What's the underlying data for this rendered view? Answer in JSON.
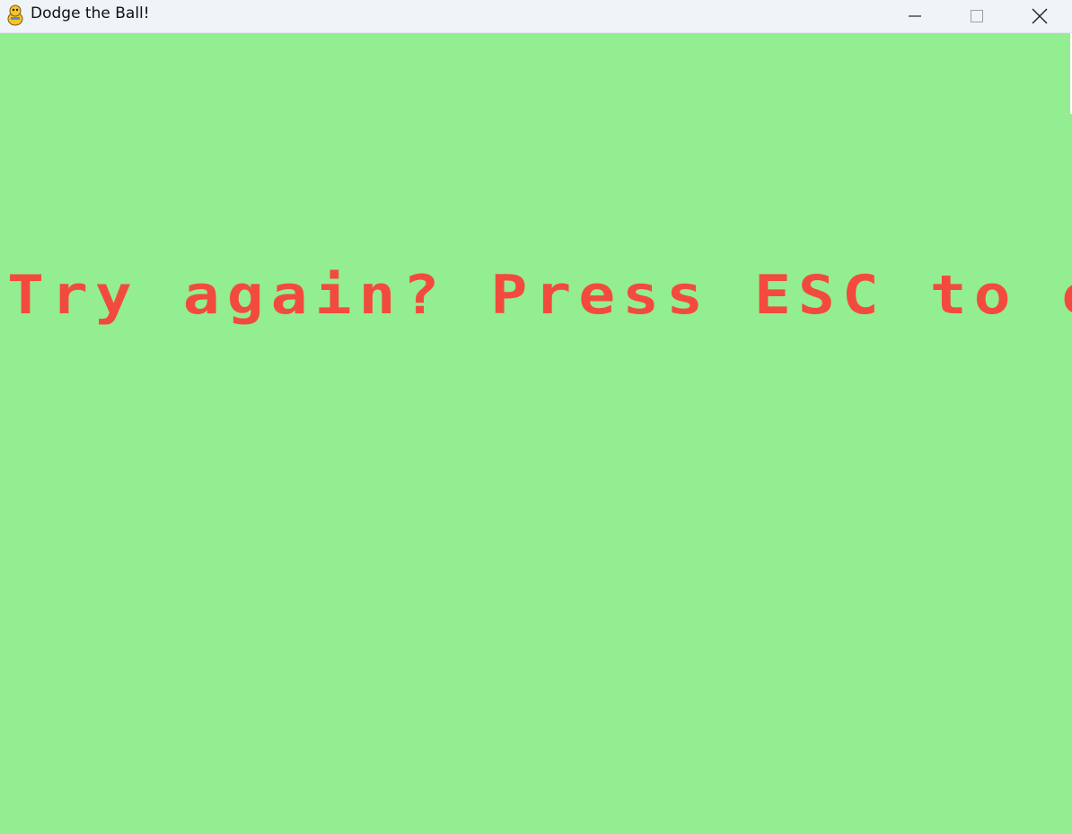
{
  "window": {
    "title": "Dodge the Ball!",
    "icon": "pygame-snake-icon"
  },
  "controls": {
    "minimize_icon": "minimize-icon",
    "maximize_icon": "maximize-icon",
    "close_icon": "close-icon"
  },
  "game": {
    "background_color": "#93ee91",
    "message_color": "#f34a3e",
    "message": "Try again? Press ESC to exit or wait"
  }
}
